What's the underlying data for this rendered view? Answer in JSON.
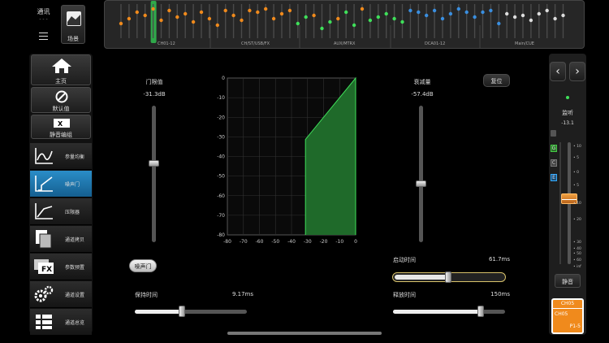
{
  "top_left": {
    "comm_label": "通讯",
    "comm_status": "- - -",
    "menu_icon": "hamburger-icon",
    "scene_label": "场景"
  },
  "overview": {
    "sections": [
      "CH01-12",
      "CH/ST/USB/FX",
      "AUX/MTRX",
      "DCA01-12",
      "Main/CUE"
    ]
  },
  "sidebar": {
    "home": "主页",
    "default": "默认值",
    "mute_group": "静音编组",
    "items": [
      {
        "label": "参量均衡",
        "icon": "eq-curve-icon",
        "active": false
      },
      {
        "label": "噪声门",
        "icon": "gate-curve-icon",
        "active": true
      },
      {
        "label": "压限器",
        "icon": "compressor-curve-icon",
        "active": false
      },
      {
        "label": "通道拷贝",
        "icon": "copy-pages-icon",
        "active": false
      },
      {
        "label": "参数预置",
        "icon": "fx-preset-icon",
        "active": false
      },
      {
        "label": "通道设置",
        "icon": "gears-icon",
        "active": false
      },
      {
        "label": "通道总览",
        "icon": "list-grid-icon",
        "active": false
      }
    ]
  },
  "gate": {
    "threshold_label": "门限值",
    "threshold_value": "-31.3dB",
    "range_label": "衰减量",
    "range_value": "-57.4dB",
    "reset_label": "复位",
    "gate_toggle_label": "噪声门",
    "attack_label": "启动时间",
    "attack_value": "61.7ms",
    "hold_label": "保持时间",
    "hold_value": "9.17ms",
    "release_label": "释放时间",
    "release_value": "150ms",
    "threshold_level": 0.42,
    "range_level": 0.57,
    "attack_level": 0.5,
    "hold_level": 0.42,
    "release_level": 0.78
  },
  "graph": {
    "x_ticks": [
      "-80",
      "-70",
      "-60",
      "-50",
      "-40",
      "-30",
      "-20",
      "-10",
      "0"
    ],
    "y_ticks": [
      "0",
      "-10",
      "-20",
      "-30",
      "-40",
      "-50",
      "-60",
      "-70",
      "-80"
    ],
    "threshold_db": -31.3,
    "range_db": -57.4,
    "fill_color": "#1f6a2a",
    "line_color": "#3fe05a"
  },
  "right_panel": {
    "monitor_label": "监听",
    "monitor_value": "-13.1",
    "mute_label": "静音",
    "channel_name": "CH05",
    "channel_label": "CH05",
    "patch_label": "P1-5",
    "scale": [
      "10",
      "5",
      "0",
      "5",
      "10",
      "20",
      "30",
      "40",
      "50",
      "60",
      "inf"
    ],
    "side_letters": [
      "G",
      "C",
      "E"
    ]
  }
}
